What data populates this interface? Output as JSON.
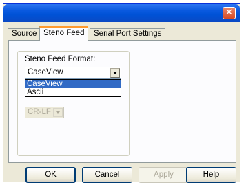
{
  "titlebar": {
    "close_symbol": "✕"
  },
  "tabs": [
    {
      "label": "Source",
      "selected": false
    },
    {
      "label": "Steno Feed",
      "selected": true
    },
    {
      "label": "Serial Port Settings",
      "selected": false
    }
  ],
  "steno_feed": {
    "group_label": "Steno Feed Format:",
    "format_value": "CaseView",
    "format_options": [
      "CaseView",
      "Ascii"
    ],
    "format_selected_index": 0,
    "line_ending_value": "CR-LF"
  },
  "buttons": {
    "ok": "OK",
    "cancel": "Cancel",
    "apply": "Apply",
    "help": "Help"
  },
  "colors": {
    "titlebar_blue": "#0a5ae0",
    "close_red": "#d64a25",
    "selection_blue": "#316ac5",
    "tab_highlight": "#ff9a2e"
  }
}
